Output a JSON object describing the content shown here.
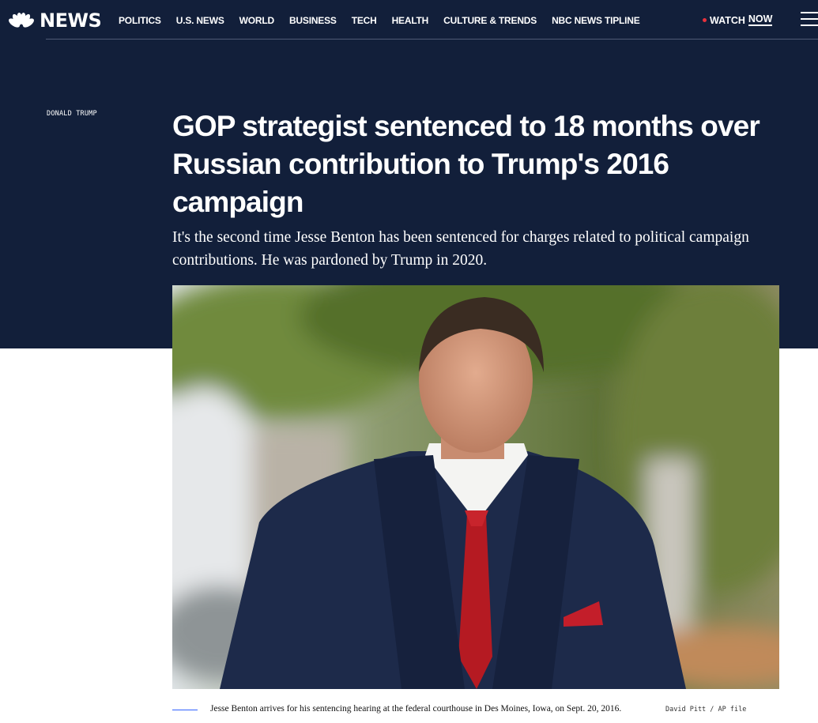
{
  "site": {
    "brand": "NEWS"
  },
  "nav": {
    "items": [
      {
        "label": "POLITICS"
      },
      {
        "label": "U.S. NEWS"
      },
      {
        "label": "WORLD"
      },
      {
        "label": "BUSINESS"
      },
      {
        "label": "TECH"
      },
      {
        "label": "HEALTH"
      },
      {
        "label": "CULTURE & TRENDS"
      },
      {
        "label": "NBC NEWS TIPLINE"
      }
    ],
    "watch_label": "WATCH",
    "watch_now": "NOW"
  },
  "article": {
    "kicker": "DONALD TRUMP",
    "headline": "GOP strategist sentenced to 18 months over Russian contribution to Trump's 2016 campaign",
    "dek": "It's the second time Jesse Benton has been sentenced for charges related to political campaign contributions. He was pardoned by Trump in 2020.",
    "caption": "Jesse Benton arrives for his sentencing hearing at the federal courthouse in Des Moines, Iowa, on Sept. 20, 2016.",
    "credit": "David Pitt / AP file"
  },
  "colors": {
    "hero_bg": "#121f3a",
    "accent_blue": "#3061ff",
    "live_red": "#e8323c"
  },
  "icons": {
    "logo": "nbc-peacock-icon",
    "menu": "hamburger-menu-icon"
  }
}
